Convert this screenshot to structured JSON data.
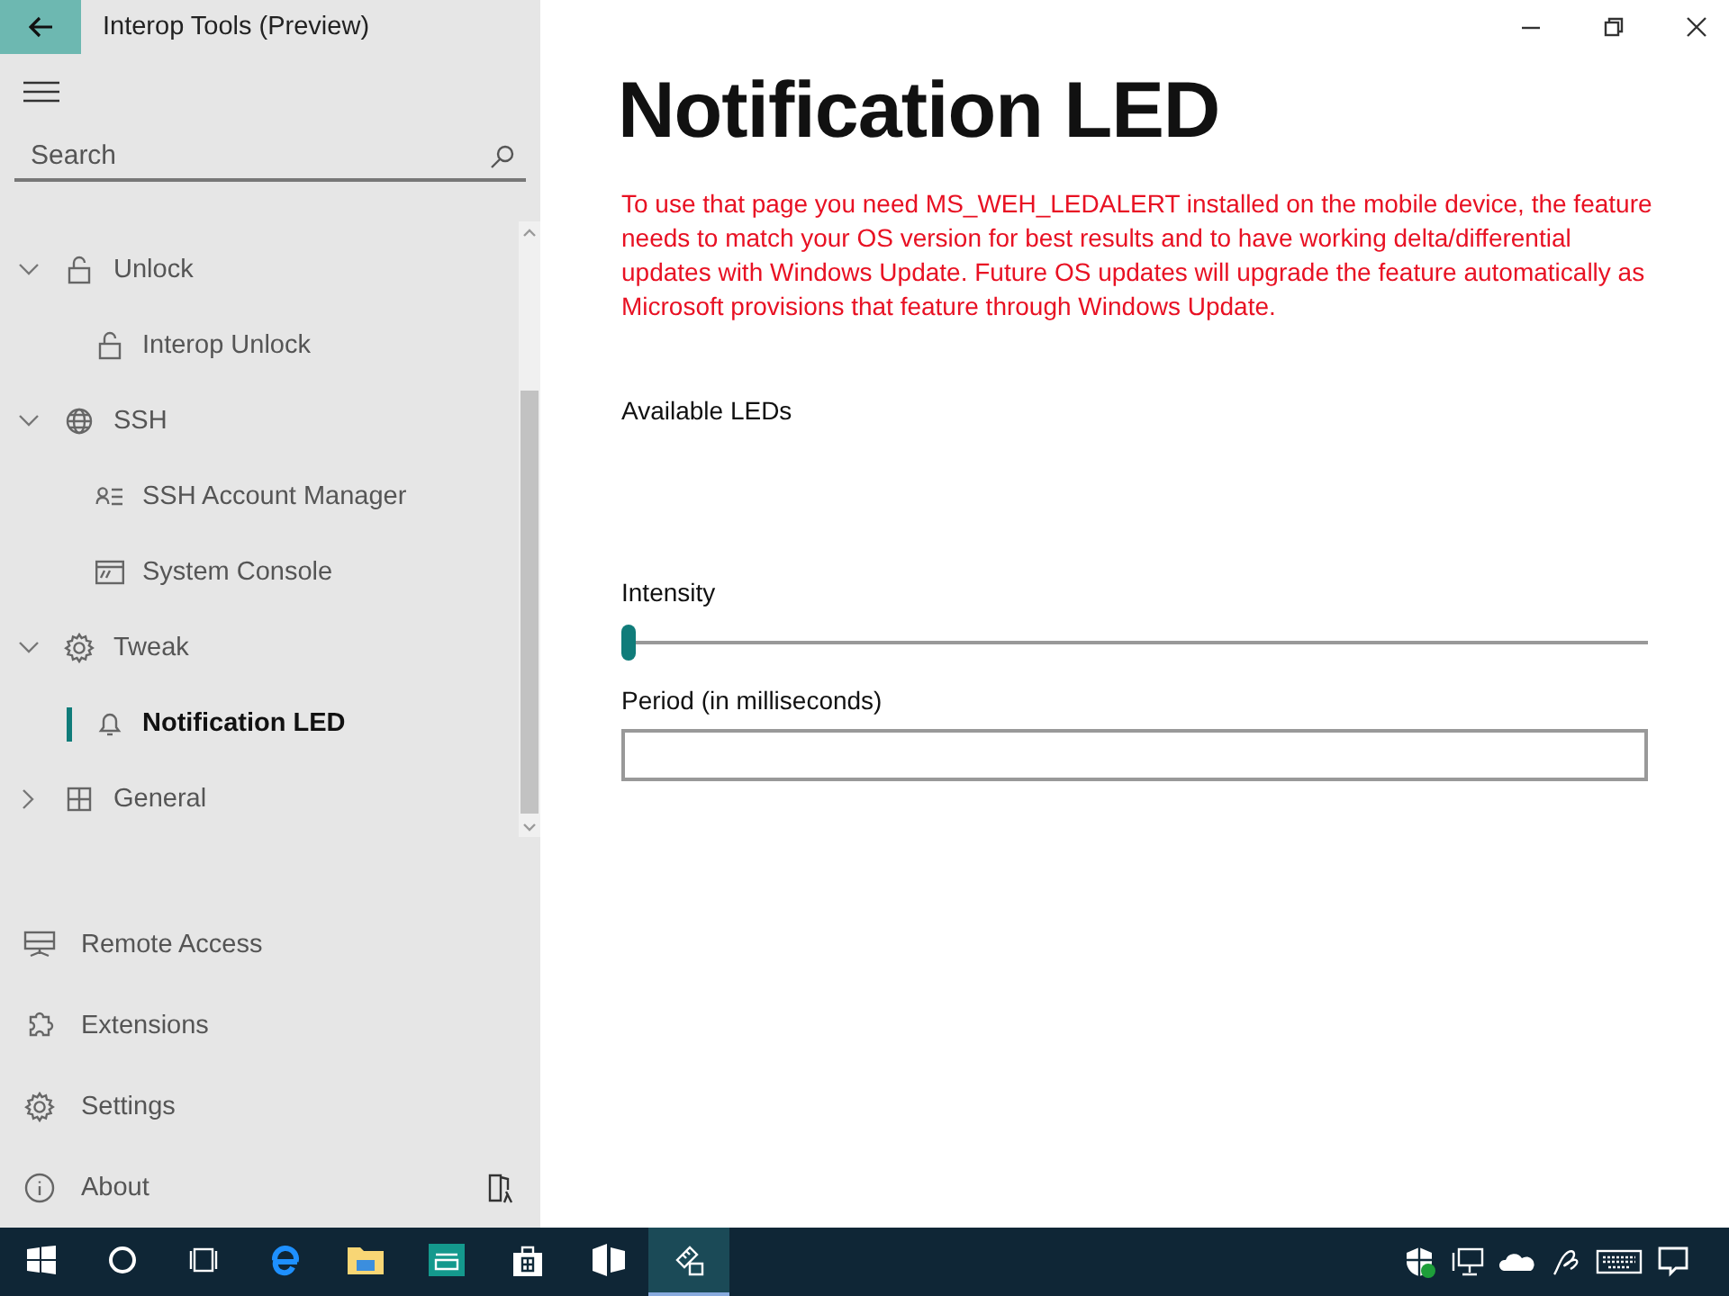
{
  "app": {
    "title": "Interop Tools (Preview)"
  },
  "search": {
    "placeholder": "Search"
  },
  "nav_tree": [
    {
      "label": "Unlock",
      "expanded": true,
      "selected": false,
      "children": [
        {
          "label": "Interop Unlock",
          "selected": false
        }
      ]
    },
    {
      "label": "SSH",
      "expanded": true,
      "selected": false,
      "children": [
        {
          "label": "SSH Account Manager",
          "selected": false
        },
        {
          "label": "System Console",
          "selected": false
        }
      ]
    },
    {
      "label": "Tweak",
      "expanded": true,
      "selected": false,
      "children": [
        {
          "label": "Notification LED",
          "selected": true
        }
      ]
    },
    {
      "label": "General",
      "expanded": false,
      "selected": false
    }
  ],
  "nav_footer": [
    {
      "label": "Remote Access",
      "selected": false
    },
    {
      "label": "Extensions",
      "selected": false
    },
    {
      "label": "Settings",
      "selected": false
    },
    {
      "label": "About",
      "selected": false
    }
  ],
  "page": {
    "title": "Notification LED",
    "warning": "To use that page you need MS_WEH_LEDALERT installed on the mobile device, the feature needs to match your OS version for best results and to have working delta/differential updates with Windows Update. Future OS updates will upgrade the feature automatically as Microsoft provisions that feature through Windows Update.",
    "leds_label": "Available LEDs",
    "intensity": {
      "label": "Intensity",
      "level": 0
    },
    "period": {
      "label": "Period (in milliseconds)"
    }
  },
  "taskbar": {
    "apps": [
      {
        "selected": false
      },
      {
        "selected": false
      },
      {
        "selected": false
      },
      {
        "selected": false
      },
      {
        "selected": false
      },
      {
        "selected": false
      },
      {
        "selected": false
      },
      {
        "selected": false
      },
      {
        "selected": true
      }
    ]
  }
}
